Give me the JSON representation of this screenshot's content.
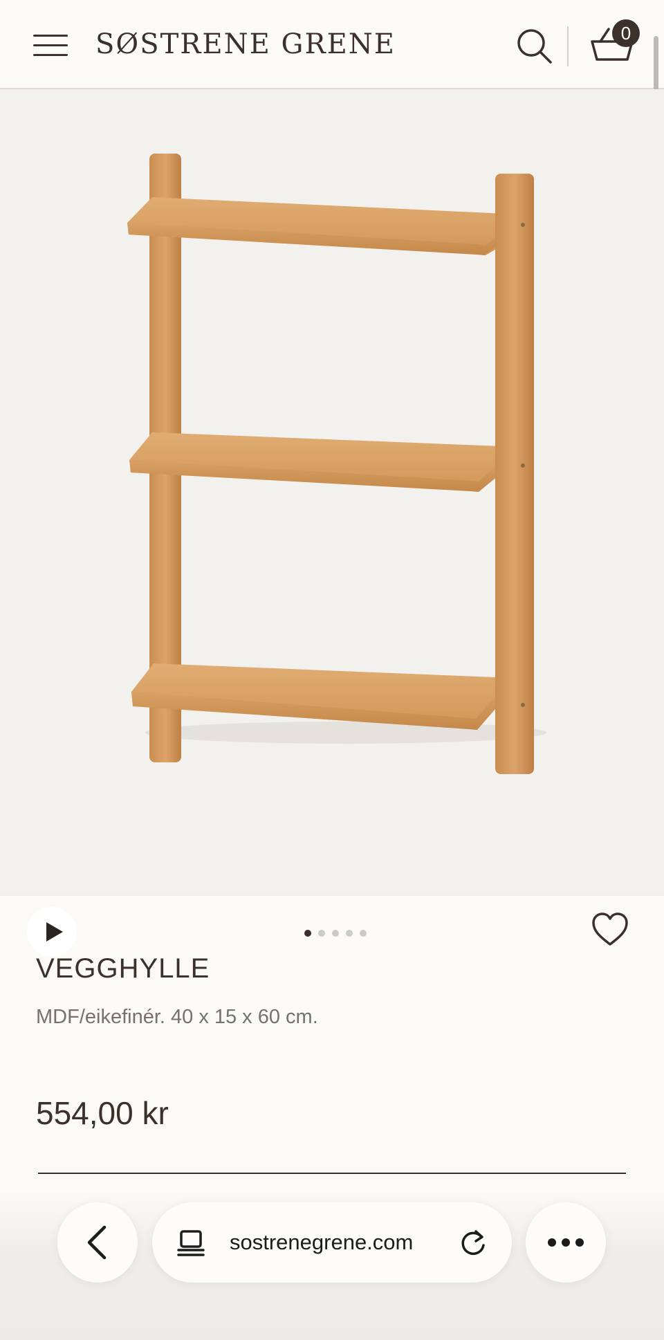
{
  "header": {
    "brand": "SØSTRENE GRENE",
    "cart_count": "0"
  },
  "gallery": {
    "slide_count": 5,
    "active_slide": 1
  },
  "product": {
    "title": "VEGGHYLLE",
    "description": "MDF/eikefinér. 40 x 15 x 60 cm.",
    "price": "554,00 kr"
  },
  "browser": {
    "url": "sostrenegrene.com"
  },
  "icons": {
    "menu": "hamburger-menu-icon",
    "search": "search-icon",
    "cart": "basket-icon",
    "play": "play-icon",
    "favorite": "heart-icon",
    "back": "chevron-left-icon",
    "tabs": "tabs-icon",
    "reload": "reload-icon",
    "more": "more-dots-icon"
  },
  "colors": {
    "text": "#3b302b",
    "background": "#fbfaf6",
    "image_background": "#f3f1ed",
    "wood": "#d9a066"
  }
}
